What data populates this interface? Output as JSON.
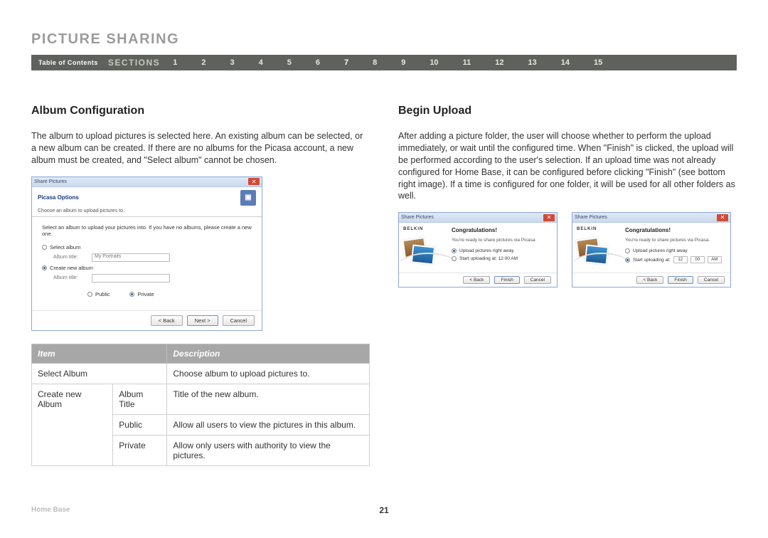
{
  "page_title": "PICTURE SHARING",
  "nav": {
    "toc": "Table of Contents",
    "sections_label": "SECTIONS",
    "links": [
      "1",
      "2",
      "3",
      "4",
      "5",
      "6",
      "7",
      "8",
      "9",
      "10",
      "11",
      "12",
      "13",
      "14",
      "15"
    ],
    "active": "7"
  },
  "left": {
    "heading": "Album Configuration",
    "paragraph": "The album to upload pictures is selected here. An existing album can be selected, or a new album can be created. If there are no albums for the Picasa account, a new album must be created, and \"Select album\" cannot be chosen.",
    "dialog": {
      "window_title": "Share Pictures",
      "head": "Picasa Options",
      "head_sub": "Choose an album to upload pictures to.",
      "hint": "Select an album to upload your pictures into. If you have no albums, please create a new one.",
      "select_album_label": "Select album",
      "album_title_label_1": "Album title:",
      "select_value": "My Portraits",
      "create_label": "Create new album",
      "album_title_label_2": "Album title:",
      "public_label": "Public",
      "private_label": "Private",
      "btn_back": "< Back",
      "btn_next": "Next >",
      "btn_cancel": "Cancel"
    },
    "table": {
      "col_item": "Item",
      "col_desc": "Description",
      "rows": [
        {
          "c1": "Select Album",
          "c2": "",
          "c3": "Choose album to upload pictures to."
        },
        {
          "c1": "Create new Album",
          "c2": "Album Title",
          "c3": "Title of the new album."
        },
        {
          "c1": "",
          "c2": "Public",
          "c3": "Allow all users to view the pictures in this album."
        },
        {
          "c1": "",
          "c2": "Private",
          "c3": "Allow only users with authority to view the pictures."
        }
      ]
    }
  },
  "right": {
    "heading": "Begin Upload",
    "paragraph": "After adding a picture folder, the user will choose whether to perform the upload immediately, or wait until the configured time. When \"Finish\" is clicked, the upload will be performed according to the user's selection. If an upload time was not already configured for Home Base, it can be configured before clicking \"Finish\" (see bottom right image). If a time is configured for one folder, it will be used for all other folders as well.",
    "dialogA": {
      "window_title": "Share Pictures",
      "brand": "BELKIN",
      "title": "Congratulations!",
      "sub": "You're ready to share pictures via Picasa.",
      "opt1": "Upload pictures right away",
      "opt2": "Start uploading at: 12:00 AM",
      "btn_back": "< Back",
      "btn_finish": "Finish",
      "btn_cancel": "Cancel"
    },
    "dialogB": {
      "window_title": "Share Pictures",
      "brand": "BELKIN",
      "title": "Congratulations!",
      "sub": "You're ready to share pictures via Picasa.",
      "opt1": "Upload pictures right away",
      "opt2_prefix": "Start uploading at:",
      "hh": "12",
      "mm": "00",
      "ap": "AM",
      "btn_back": "< Back",
      "btn_finish": "Finish",
      "btn_cancel": "Cancel"
    }
  },
  "footer": {
    "left": "Home Base",
    "page": "21"
  }
}
